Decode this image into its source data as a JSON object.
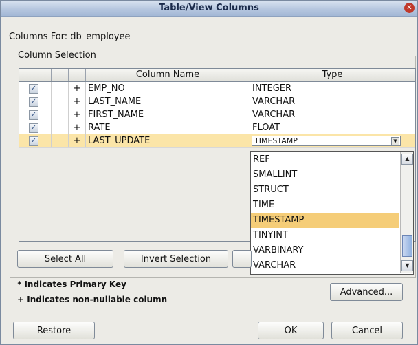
{
  "dialog": {
    "title": "Table/View Columns",
    "close_glyph": "✕",
    "columns_for": "Columns For: db_employee",
    "group_label": "Column Selection"
  },
  "table": {
    "headers": [
      "",
      "",
      "",
      "Column Name",
      "Type"
    ],
    "rows": [
      {
        "checked": true,
        "flag": "+",
        "name": "EMP_NO",
        "type": "INTEGER"
      },
      {
        "checked": true,
        "flag": "+",
        "name": "LAST_NAME",
        "type": "VARCHAR"
      },
      {
        "checked": true,
        "flag": "+",
        "name": "FIRST_NAME",
        "type": "VARCHAR"
      },
      {
        "checked": true,
        "flag": "+",
        "name": "RATE",
        "type": "FLOAT"
      },
      {
        "checked": true,
        "flag": "+",
        "name": "LAST_UPDATE",
        "type": "TIMESTAMP",
        "selected": true
      }
    ],
    "check_glyph": "✓"
  },
  "type_dropdown": {
    "options": [
      "REF",
      "SMALLINT",
      "STRUCT",
      "TIME",
      "TIMESTAMP",
      "TINYINT",
      "VARBINARY",
      "VARCHAR"
    ],
    "highlighted": "TIMESTAMP"
  },
  "buttons": {
    "select_all": "Select All",
    "invert_selection": "Invert Selection",
    "advanced": "Advanced...",
    "restore": "Restore",
    "ok": "OK",
    "cancel": "Cancel"
  },
  "legend": {
    "primary_key": "* Indicates Primary Key",
    "non_nullable": "+ Indicates non-nullable column"
  },
  "colors": {
    "selected_row": "#fbe5a8",
    "highlight": "#f5cd78",
    "title_bar": "#b6c7df"
  }
}
